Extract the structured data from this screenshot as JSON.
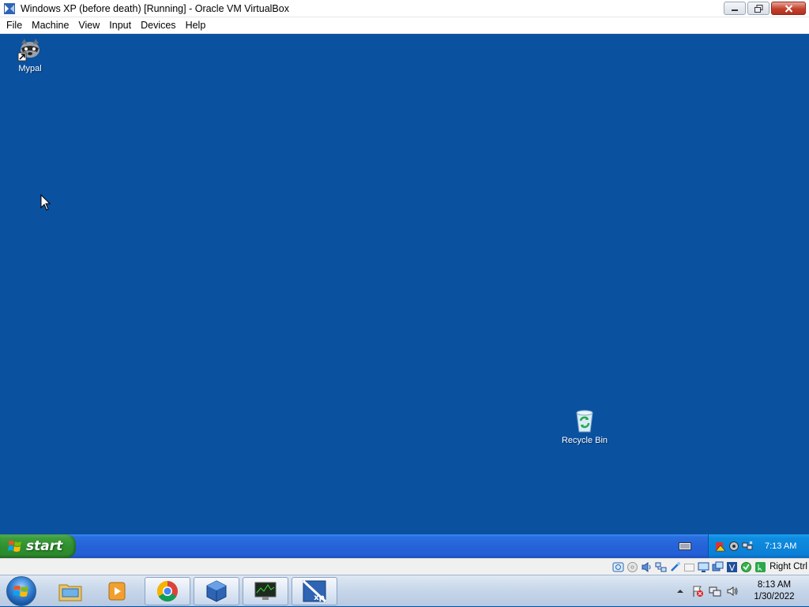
{
  "window": {
    "title": "Windows XP (before death) [Running] - Oracle VM VirtualBox",
    "icon": "virtualbox-icon"
  },
  "menubar": {
    "items": [
      "File",
      "Machine",
      "View",
      "Input",
      "Devices",
      "Help"
    ]
  },
  "desktop": {
    "background": "#0a51a0",
    "icons": [
      {
        "label": "Mypal",
        "icon": "raccoon-browser-shortcut-icon"
      },
      {
        "label": "Recycle Bin",
        "icon": "recycle-bin-icon"
      }
    ]
  },
  "xp_taskbar": {
    "start_label": "start",
    "tray_clock": "7:13 AM",
    "tray_icons": [
      "security-alert-icon",
      "audio-icon",
      "network-icon"
    ],
    "keyboard_icon": "keyboard-layout-icon"
  },
  "vbox_status": {
    "host_key": "Right Ctrl",
    "indicators": [
      "hard-disk-icon",
      "optical-drive-icon",
      "audio-icon",
      "network-icon",
      "usb-icon",
      "shared-folders-icon",
      "display-icon",
      "video-capture-icon",
      "screen-icon",
      "cpu-icon",
      "mouse-integration-icon",
      "keyboard-icon"
    ]
  },
  "host_taskbar": {
    "pinned": [
      "windows-explorer-icon",
      "media-player-icon",
      "chrome-icon",
      "virtualbox-icon",
      "task-manager-icon",
      "windows-xp-vm-icon"
    ],
    "clock_time": "8:13 AM",
    "clock_date": "1/30/2022"
  }
}
